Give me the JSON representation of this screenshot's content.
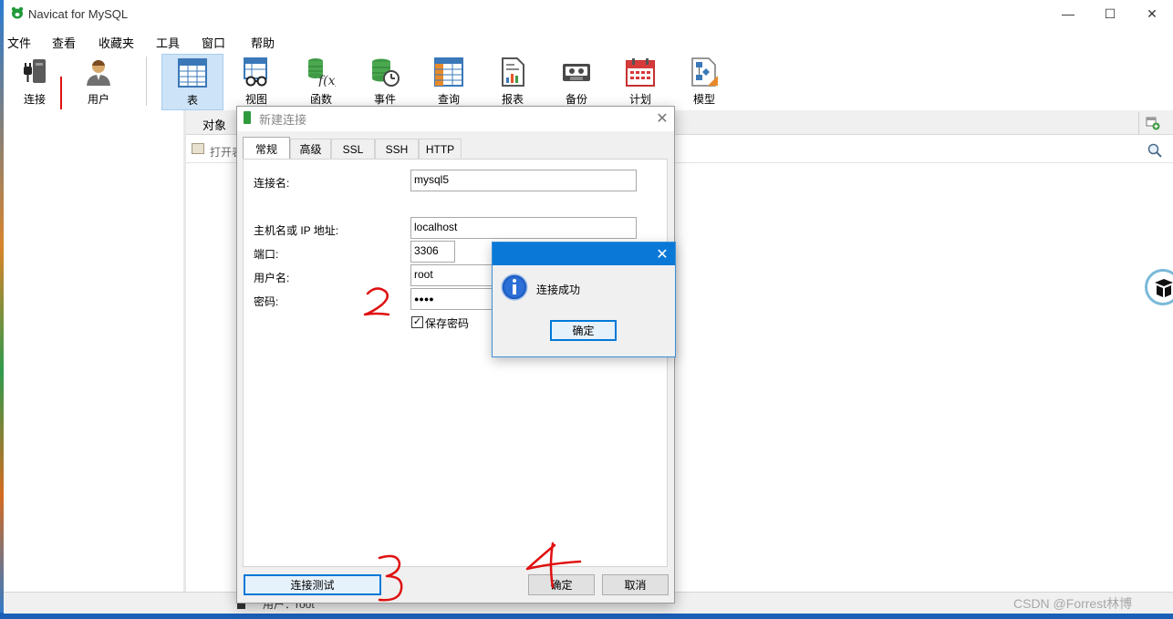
{
  "app": {
    "title": "Navicat for MySQL"
  },
  "window_controls": {
    "minimize": "—",
    "maximize": "☐",
    "close": "✕"
  },
  "menu": [
    "文件",
    "查看",
    "收藏夹",
    "工具",
    "窗口",
    "帮助"
  ],
  "toolbar": [
    {
      "label": "连接",
      "icon": "plug-icon"
    },
    {
      "label": "用户",
      "icon": "user-icon"
    },
    {
      "label": "表",
      "icon": "table-icon",
      "active": true
    },
    {
      "label": "视图",
      "icon": "view-icon"
    },
    {
      "label": "函数",
      "icon": "function-icon"
    },
    {
      "label": "事件",
      "icon": "event-icon"
    },
    {
      "label": "查询",
      "icon": "query-icon"
    },
    {
      "label": "报表",
      "icon": "report-icon"
    },
    {
      "label": "备份",
      "icon": "backup-icon"
    },
    {
      "label": "计划",
      "icon": "schedule-icon"
    },
    {
      "label": "模型",
      "icon": "model-icon"
    }
  ],
  "object_tab": "对象",
  "object_toolbar": {
    "open_table": "打开表"
  },
  "status_bar": {
    "user": "用户：root"
  },
  "watermark": "CSDN @Forrest林博",
  "dialog": {
    "title": "新建连接",
    "close": "✕",
    "tabs": [
      "常规",
      "高级",
      "SSL",
      "SSH",
      "HTTP"
    ],
    "fields": {
      "connection_name": {
        "label": "连接名:",
        "value": "mysql5"
      },
      "host": {
        "label": "主机名或 IP 地址:",
        "value": "localhost"
      },
      "port": {
        "label": "端口:",
        "value": "3306"
      },
      "username": {
        "label": "用户名:",
        "value": "root"
      },
      "password": {
        "label": "密码:",
        "value": "●●●●"
      }
    },
    "save_password": {
      "label": "保存密码",
      "checked": true,
      "mark": "✓"
    },
    "buttons": {
      "test": "连接测试",
      "ok": "确定",
      "cancel": "取消"
    }
  },
  "message_box": {
    "close": "✕",
    "icon": "info-icon",
    "text": "连接成功",
    "ok": "确定"
  },
  "annotations": [
    "2",
    "3",
    "4"
  ],
  "colors": {
    "accent": "#0a78d7",
    "annotation_red": "#e01010",
    "toolbar_active": "#cde3f7"
  }
}
